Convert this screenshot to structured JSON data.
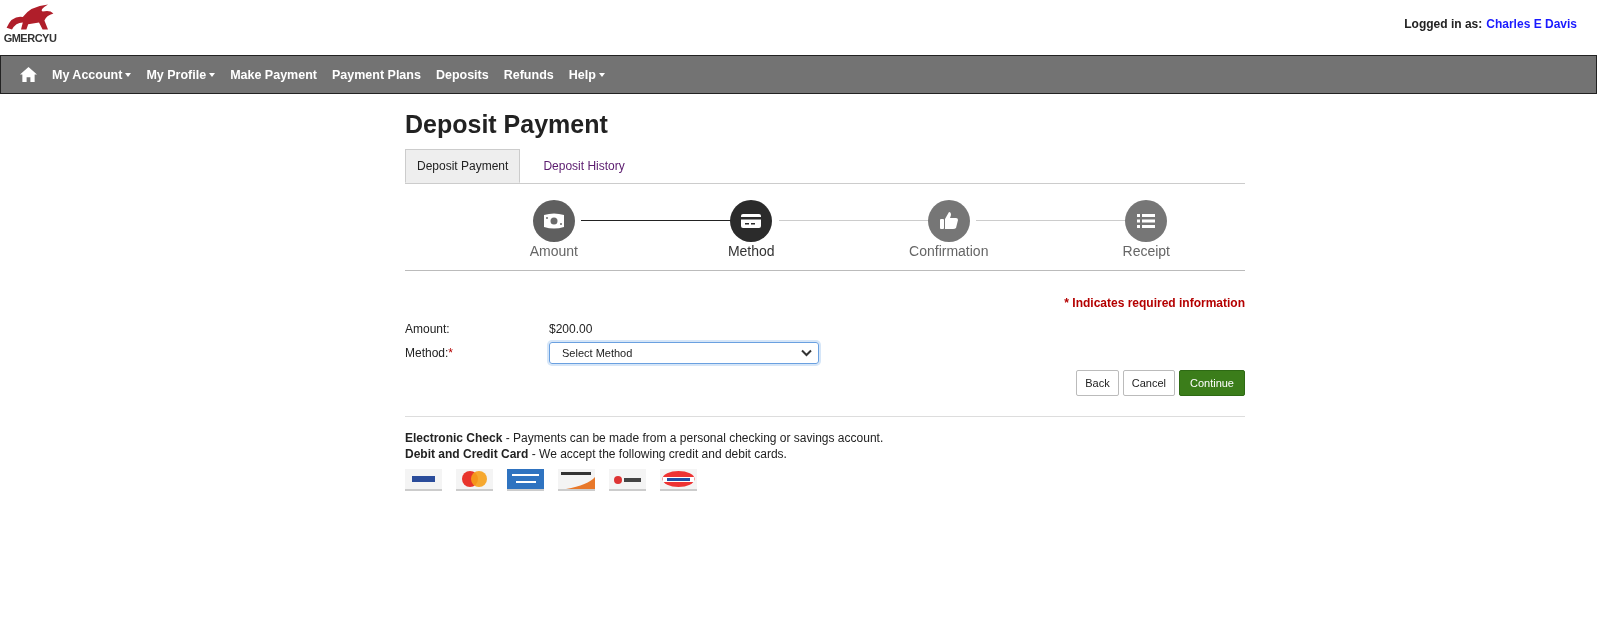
{
  "logo": {
    "wordmark": "GMERCYU"
  },
  "login": {
    "label": "Logged in as:",
    "user": "Charles E Davis"
  },
  "nav": [
    {
      "label": "My Account",
      "dropdown": true
    },
    {
      "label": "My Profile",
      "dropdown": true
    },
    {
      "label": "Make Payment",
      "dropdown": false
    },
    {
      "label": "Payment Plans",
      "dropdown": false
    },
    {
      "label": "Deposits",
      "dropdown": false
    },
    {
      "label": "Refunds",
      "dropdown": false
    },
    {
      "label": "Help",
      "dropdown": true
    }
  ],
  "page_title": "Deposit Payment",
  "tabs": [
    {
      "label": "Deposit Payment",
      "selected": true
    },
    {
      "label": "Deposit History",
      "selected": false
    }
  ],
  "steps": [
    {
      "label": "Amount",
      "kind": "money",
      "completed": true,
      "current": false
    },
    {
      "label": "Method",
      "kind": "card",
      "completed": false,
      "current": true
    },
    {
      "label": "Confirmation",
      "kind": "thumb",
      "completed": false,
      "current": false
    },
    {
      "label": "Receipt",
      "kind": "list",
      "completed": false,
      "current": false
    }
  ],
  "required_note": "* Indicates required information",
  "form": {
    "amount_label": "Amount:",
    "amount_value": "$200.00",
    "method_label": "Method:",
    "required_mark": "*",
    "method_placeholder": "Select Method"
  },
  "buttons": [
    {
      "label": "Back",
      "kind": "default"
    },
    {
      "label": "Cancel",
      "kind": "default"
    },
    {
      "label": "Continue",
      "kind": "primary"
    }
  ],
  "info": [
    {
      "term": "Electronic Check",
      "text": " - Payments can be made from a personal checking or savings account."
    },
    {
      "term": "Debit and Credit Card",
      "text": " - We accept the following credit and debit cards."
    }
  ],
  "cards": [
    {
      "kind": "visa"
    },
    {
      "kind": "mastercard"
    },
    {
      "kind": "amex"
    },
    {
      "kind": "discover"
    },
    {
      "kind": "bccard"
    },
    {
      "kind": "dinacard"
    }
  ]
}
